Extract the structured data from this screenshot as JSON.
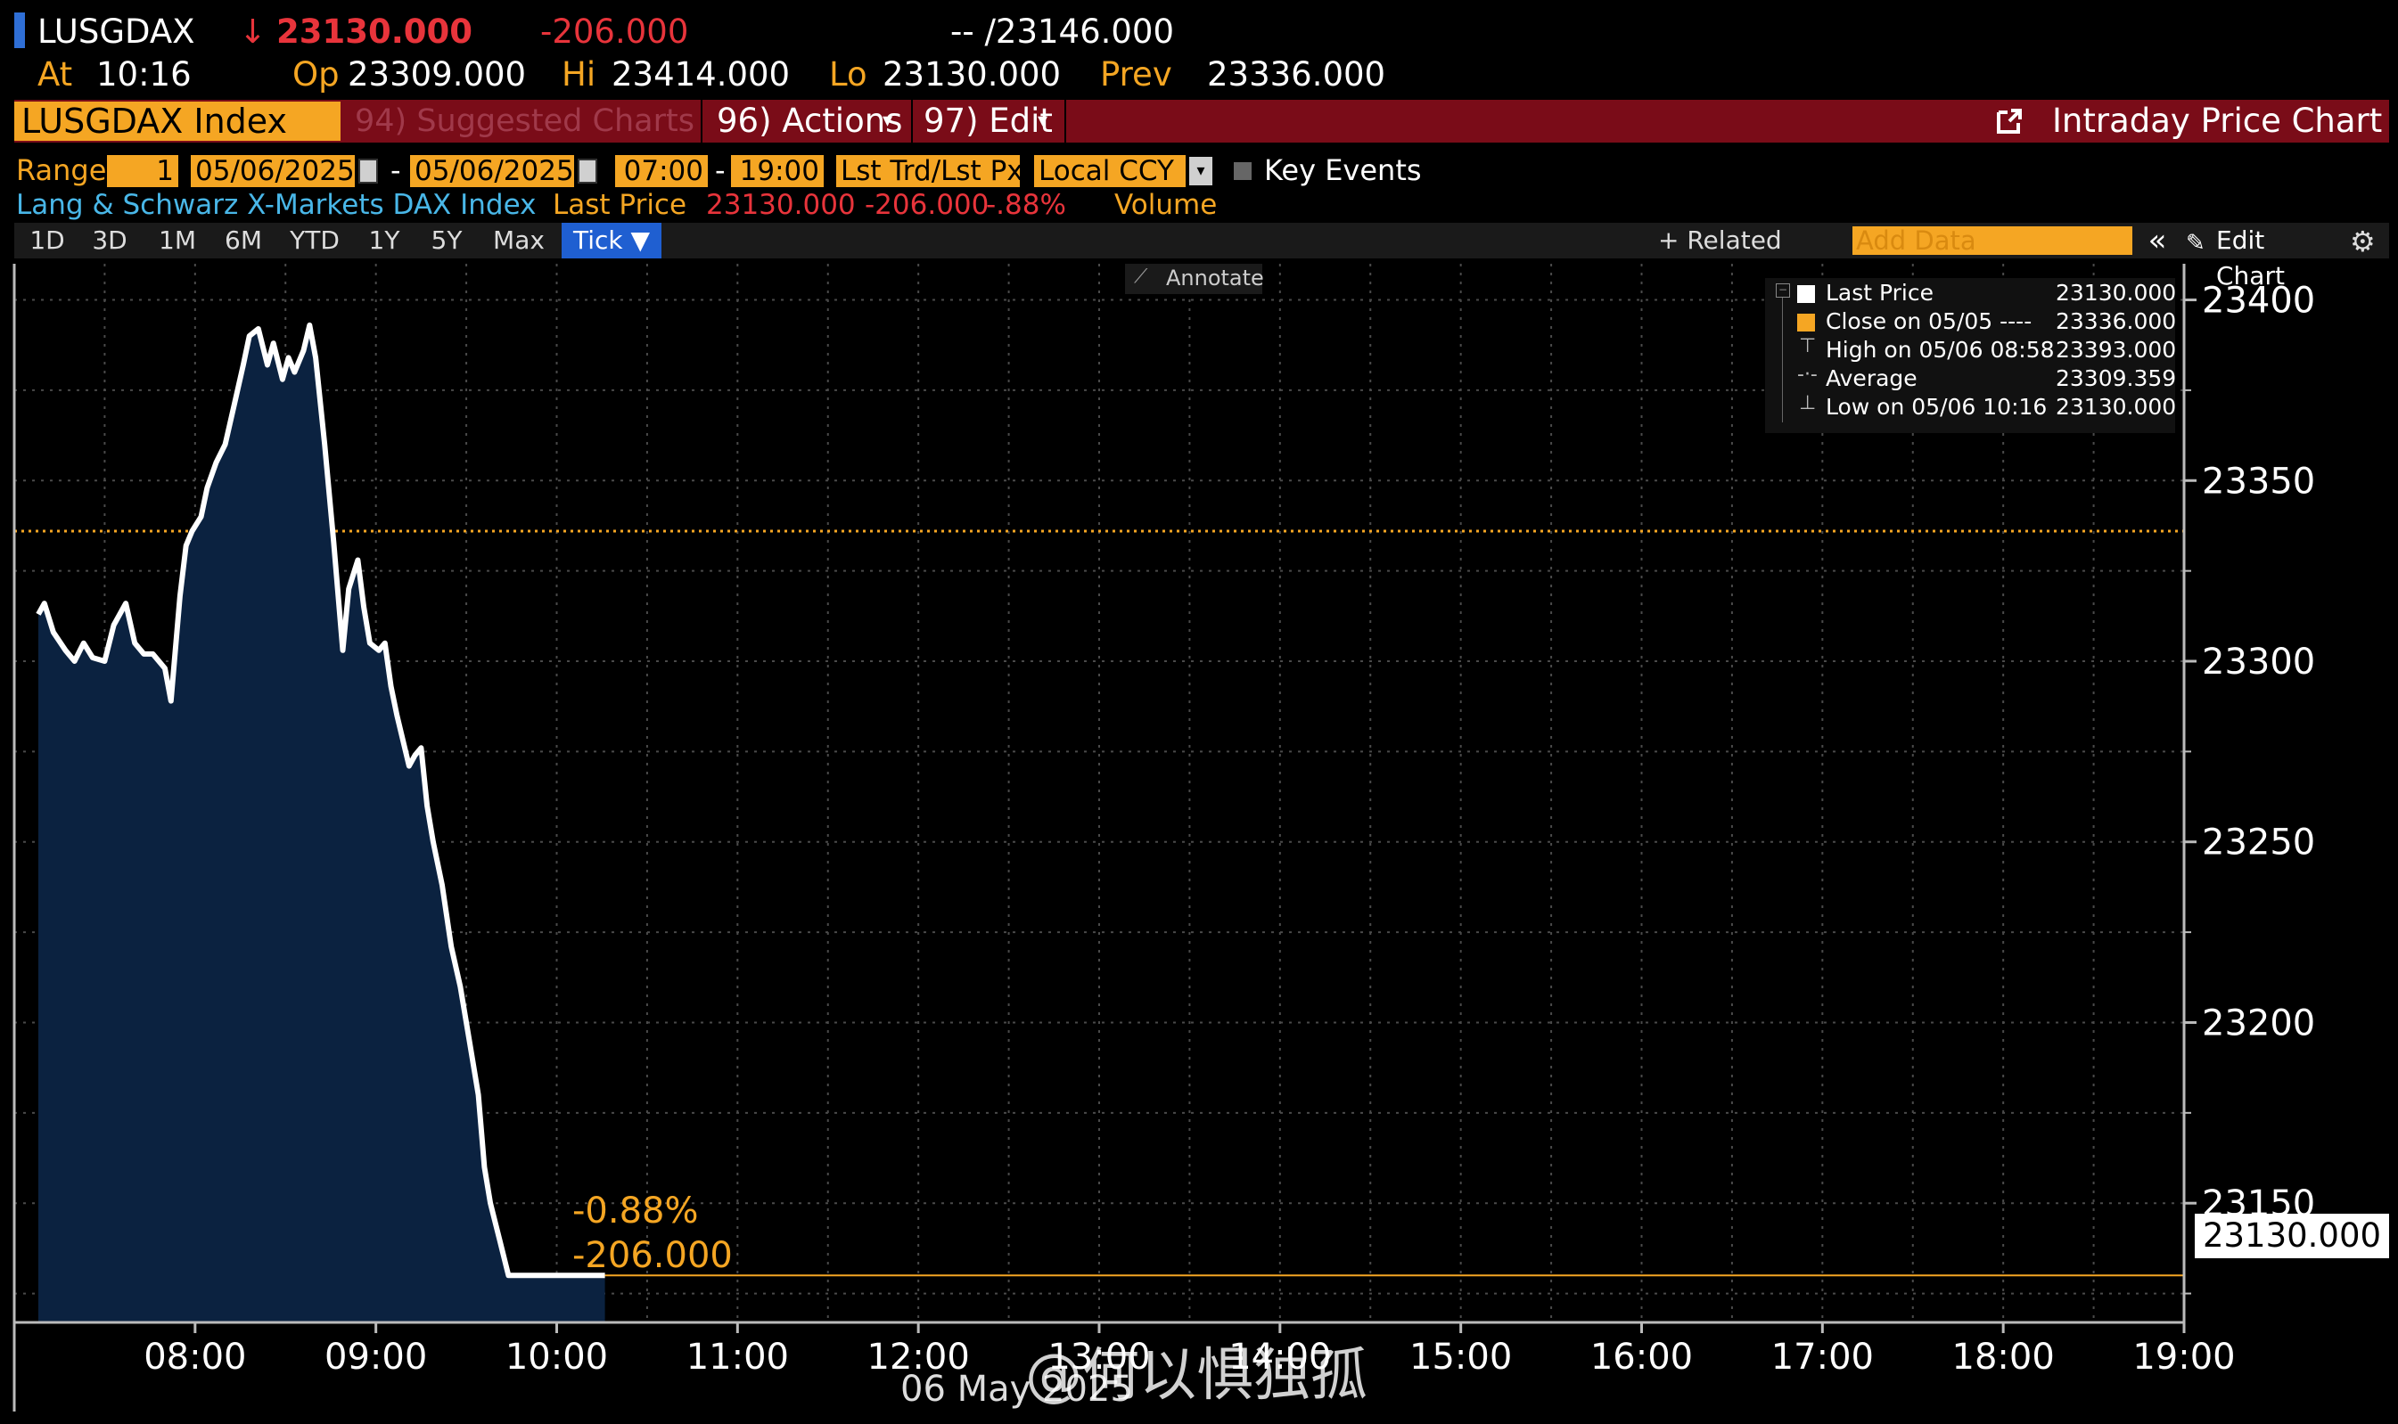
{
  "header": {
    "ticker": "LUSGDAX",
    "arrow": "↓",
    "last": "23130.000",
    "change": "-206.000",
    "bidask": "-- /23146.000",
    "at_label": "At",
    "at_time": "10:16",
    "op_label": "Op",
    "op": "23309.000",
    "hi_label": "Hi",
    "hi": "23414.000",
    "lo_label": "Lo",
    "lo": "23130.000",
    "prev_label": "Prev",
    "prev": "23336.000"
  },
  "menubar": {
    "security": "LUSGDAX Index",
    "suggested": "94) Suggested Charts",
    "actions": "96) Actions",
    "edit": "97) Edit",
    "title": "Intraday Price Chart"
  },
  "controls": {
    "range_label": "Range",
    "range_value": "1",
    "date_from": "05/06/2025",
    "dash": "-",
    "date_to": "05/06/2025",
    "time_from": "07:00",
    "time_to": "19:00",
    "price_type": "Lst Trd/Lst Px",
    "currency": "Local CCY",
    "key_events": "Key Events"
  },
  "info": {
    "name": "Lang & Schwarz X-Markets DAX Index",
    "last_label": "Last Price",
    "last_value": "23130.000",
    "change": "-206.000",
    "pct": "-.88%",
    "volume": "Volume"
  },
  "periods": [
    "1D",
    "3D",
    "1M",
    "6M",
    "YTD",
    "1Y",
    "5Y",
    "Max"
  ],
  "tick_label": "Tick ▼",
  "toolbar": {
    "related": "+ Related Data",
    "add_data_placeholder": "Add Data",
    "collapse": "«",
    "edit_chart": "Edit Chart",
    "annotate": "Annotate"
  },
  "legend": [
    {
      "label": "Last Price",
      "value": "23130.000",
      "color": "#ffffff"
    },
    {
      "label": "Close on 05/05 ----",
      "value": "23336.000",
      "color": "#f5a623"
    },
    {
      "label": "High on 05/06 08:58",
      "value": "23393.000",
      "color": "#bbbbbb"
    },
    {
      "label": "Average",
      "value": "23309.359",
      "color": "#bbbbbb"
    },
    {
      "label": "Low on 05/06 10:16",
      "value": "23130.000",
      "color": "#bbbbbb"
    }
  ],
  "annotation": {
    "pct": "-0.88%",
    "abs": "-206.000"
  },
  "last_tag": "23130.000",
  "x_axis_date": "06 May 2025",
  "watermark": "@何以惧独孤",
  "colors": {
    "accent": "#f5a623",
    "menu_red": "#7a0c18",
    "area_fill": "#0b2240",
    "grid": "#444444",
    "negative": "#e8343b"
  },
  "chart_data": {
    "type": "area",
    "title": "Intraday Price Chart",
    "series": [
      {
        "name": "Last Price",
        "x": [
          "07:08",
          "07:10",
          "07:13",
          "07:17",
          "07:20",
          "07:23",
          "07:26",
          "07:30",
          "07:33",
          "07:37",
          "07:40",
          "07:43",
          "07:46",
          "07:50",
          "07:52",
          "07:55",
          "07:57",
          "07:59",
          "08:02",
          "08:04",
          "08:07",
          "08:10",
          "08:13",
          "08:16",
          "08:18",
          "08:21",
          "08:24",
          "08:26",
          "08:29",
          "08:31",
          "08:33",
          "08:36",
          "08:38",
          "08:40",
          "08:43",
          "08:46",
          "08:49",
          "08:51",
          "08:54",
          "08:56",
          "08:58",
          "09:01",
          "09:03",
          "09:05",
          "09:07",
          "09:09",
          "09:11",
          "09:13",
          "09:15",
          "09:17",
          "09:19",
          "09:22",
          "09:25",
          "09:28",
          "09:31",
          "09:34",
          "09:36",
          "09:38",
          "09:41",
          "09:44",
          "09:47",
          "09:50",
          "09:52",
          "09:55",
          "09:57",
          "09:59",
          "10:02",
          "10:05",
          "10:07",
          "10:09",
          "10:11",
          "10:13",
          "10:15",
          "10:16"
        ],
        "values": [
          23313,
          23316,
          23308,
          23303,
          23300,
          23305,
          23301,
          23300,
          23310,
          23316,
          23305,
          23302,
          23302,
          23298,
          23289,
          23318,
          23332,
          23336,
          23340,
          23348,
          23355,
          23360,
          23371,
          23382,
          23390,
          23392,
          23382,
          23388,
          23378,
          23384,
          23380,
          23386,
          23393,
          23384,
          23360,
          23333,
          23303,
          23320,
          23328,
          23315,
          23305,
          23303,
          23305,
          23293,
          23285,
          23278,
          23271,
          23274,
          23276,
          23260,
          23250,
          23238,
          23221,
          23210,
          23195,
          23180,
          23160,
          23150,
          23140,
          23130,
          23130,
          23130,
          23130,
          23130,
          23130,
          23130,
          23130,
          23130,
          23130,
          23130,
          23130,
          23130,
          23130,
          23130
        ]
      }
    ],
    "close_prev": 23336,
    "last": 23130,
    "x_ticks": [
      "08:00",
      "09:00",
      "10:00",
      "11:00",
      "12:00",
      "13:00",
      "14:00",
      "15:00",
      "16:00",
      "17:00",
      "18:00",
      "19:00"
    ],
    "y_ticks": [
      23150,
      23200,
      23250,
      23300,
      23350,
      23400
    ],
    "xlim": [
      "07:00",
      "19:00"
    ],
    "ylim": [
      23117,
      23410
    ],
    "grid": true,
    "legend_position": "top-right"
  }
}
